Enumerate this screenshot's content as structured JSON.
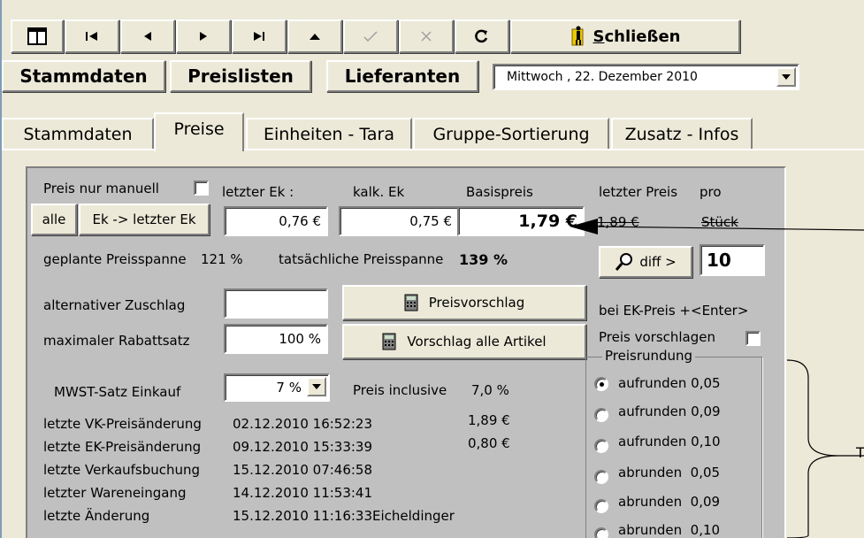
{
  "toolbar": {
    "icons": [
      "layout-icon",
      "first-record-icon",
      "previous-record-icon",
      "next-record-icon",
      "last-record-icon",
      "up-icon",
      "confirm-icon",
      "cancel-icon",
      "refresh-icon",
      "exit-icon"
    ],
    "close_label_underlined": "S",
    "close_label_rest": "chließen"
  },
  "mainbuttons": {
    "stammdaten": "Stammdaten",
    "preislisten": "Preislisten",
    "lieferanten": "Lieferanten"
  },
  "date": {
    "value": "Mittwoch , 22. Dezember 2010"
  },
  "tabs": [
    "Stammdaten",
    "Preise",
    "Einheiten - Tara",
    "Gruppe-Sortierung",
    "Zusatz - Infos"
  ],
  "active_tab": "Preise",
  "prices": {
    "preis_nur_manuell_label": "Preis nur manuell",
    "letzter_ek_label": "letzter Ek :",
    "kalk_ek_label": "kalk. Ek",
    "basispreis_label": "Basispreis",
    "letzter_preis_label": "letzter Preis",
    "pro_label": "pro",
    "alle_button": "alle",
    "ek_letzter_button": "Ek -> letzter Ek",
    "letzter_ek_value": "0,76 €",
    "kalk_ek_value": "0,75 €",
    "basispreis_value": "1,79 €",
    "letzter_preis_value": "1,89 €",
    "einheit_value": "Stück",
    "geplante_label": "geplante Preisspanne",
    "geplante_value": "121 %",
    "tatsaechliche_label": "tatsächliche Preisspanne",
    "tatsaechliche_value": "139 %",
    "diff_button": "diff >",
    "diff_value": "10",
    "alternativer_label": "alternativer Zuschlag",
    "alternativer_value": "",
    "preisvorschlag_button": "Preisvorschlag",
    "bei_ek_label": "bei EK-Preis +<Enter>",
    "maximaler_label": "maximaler Rabattsatz",
    "maximaler_value": "100 %",
    "vorschlag_alle_button": "Vorschlag alle Artikel",
    "preis_vorschlagen_label": "Preis vorschlagen",
    "mwst_label": "MWST-Satz Einkauf",
    "mwst_value": "7 %",
    "preis_inclusive_label": "Preis inclusive",
    "preis_inclusive_value": "7,0 %"
  },
  "history": [
    {
      "label": "letzte VK-Preisänderung",
      "date": "02.12.2010 16:52:23",
      "extra": "1,89 €"
    },
    {
      "label": "letzte EK-Preisänderung",
      "date": "09.12.2010 15:33:39",
      "extra": "0,80 €"
    },
    {
      "label": "letzte Verkaufsbuchung",
      "date": "15.12.2010 07:46:58",
      "extra": ""
    },
    {
      "label": "letzter Wareneingang",
      "date": "14.12.2010 11:53:41",
      "extra": ""
    },
    {
      "label": "letzte Änderung",
      "date": "15.12.2010 11:16:33",
      "extra": "Eicheldinger"
    }
  ],
  "rounding": {
    "title": "Preisrundung",
    "options": [
      "aufrunden 0,05",
      "aufrunden 0,09",
      "aufrunden 0,10",
      "abrunden  0,05",
      "abrunden  0,09",
      "abrunden  0,10"
    ],
    "selected": "aufrunden 0,05"
  },
  "annotations": {
    "tail_text": "T"
  }
}
